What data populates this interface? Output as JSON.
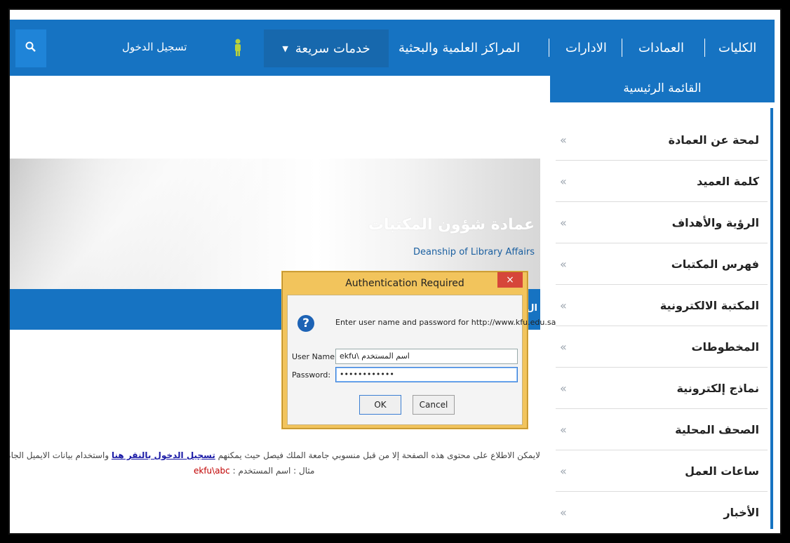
{
  "topnav": {
    "items": [
      "الكليات",
      "العمادات",
      "الادارات",
      "المراكز العلمية والبحثية"
    ],
    "quick_services": "خدمات سريعة",
    "login": "تسجيل الدخول",
    "search_icon": "search-icon",
    "person_icon": "person-icon"
  },
  "banner": {
    "title_ar": "عمادة شؤون المكتبات",
    "title_en": "Deanship of Library Affairs",
    "bar_stub": "ال"
  },
  "sidebar": {
    "heading": "القائمة الرئيسية",
    "items": [
      {
        "label": "لمحة عن العمادة"
      },
      {
        "label": "كلمة العميد"
      },
      {
        "label": "الرؤية والأهداف"
      },
      {
        "label": "فهرس المكتبات"
      },
      {
        "label": "المكتبة الالكترونية"
      },
      {
        "label": "المخطوطات"
      },
      {
        "label": "نماذج إلكترونية"
      },
      {
        "label": "الصحف المحلية"
      },
      {
        "label": "ساعات العمل"
      },
      {
        "label": "الأخبار"
      }
    ],
    "chevron": "«"
  },
  "notice": {
    "line1_pre": "لايمكن الاطلاع على محتوى هذه الصفحة إلا من قبل منسوبي جامعة الملك فيصل حيث يمكنهم ",
    "line1_link": "تسجيل الدخول بالنقر هنا",
    "line1_post": " واستخدام بيانات الايميل الجامعي",
    "line2_label": "مثال : اسم المستخدم : ",
    "line2_example": "ekfu\\abc"
  },
  "dialog": {
    "title": "Authentication Required",
    "close": "×",
    "message": "Enter user name and password for http://www.kfu.edu.sa",
    "username_label": "User Name:",
    "username_value": "ekfu\\ اسم المستخدم",
    "password_label": "Password:",
    "password_value": "••••••••••••",
    "ok": "OK",
    "cancel": "Cancel"
  }
}
